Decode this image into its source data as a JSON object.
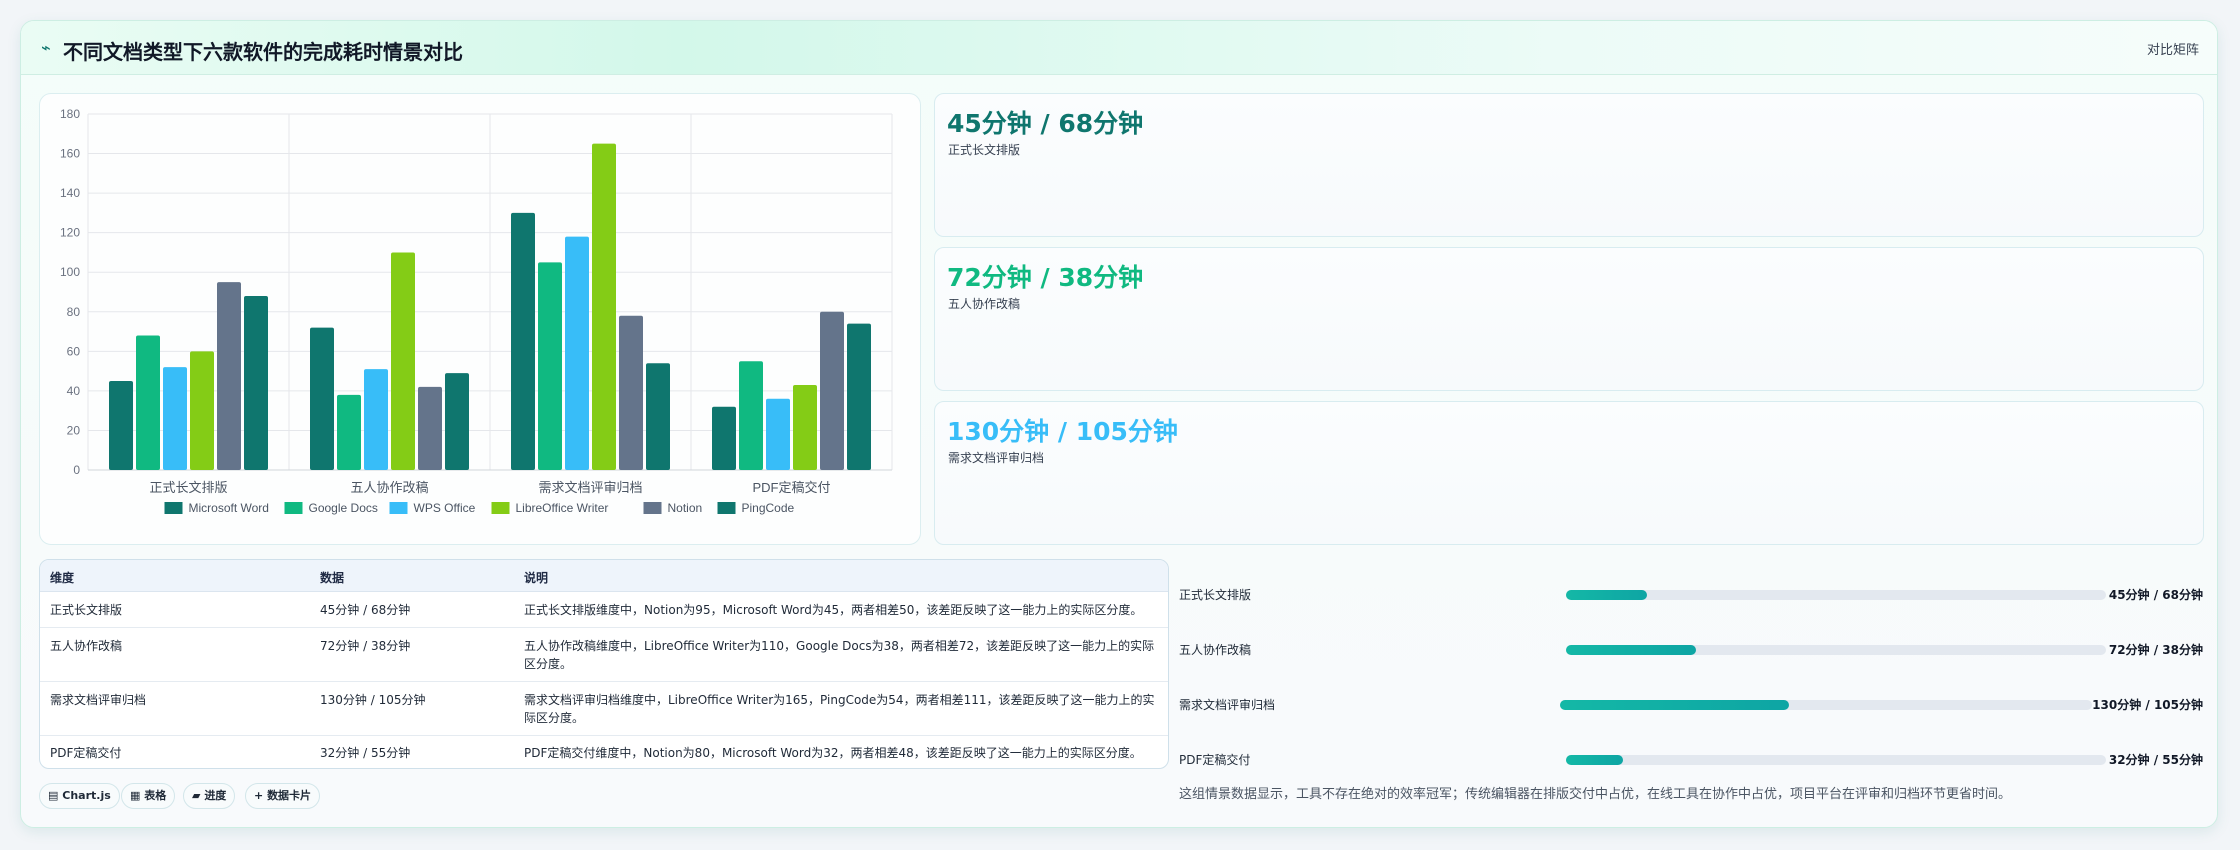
{
  "header": {
    "logo_icon": "trend-icon",
    "title": "不同文档类型下六款软件的完成耗时情景对比",
    "badge": "对比矩阵"
  },
  "chart_data": {
    "type": "bar",
    "categories": [
      "正式长文排版",
      "五人协作改稿",
      "需求文档评审归档",
      "PDF定稿交付"
    ],
    "series": [
      {
        "name": "Microsoft Word",
        "color": "#0f766e",
        "values": [
          45,
          72,
          130,
          32
        ]
      },
      {
        "name": "Google Docs",
        "color": "#10b981",
        "values": [
          68,
          38,
          105,
          55
        ]
      },
      {
        "name": "WPS Office",
        "color": "#38bdf8",
        "values": [
          52,
          51,
          118,
          36
        ]
      },
      {
        "name": "LibreOffice Writer",
        "color": "#84cc16",
        "values": [
          60,
          110,
          165,
          43
        ]
      },
      {
        "name": "Notion",
        "color": "#64748b",
        "values": [
          95,
          42,
          78,
          80
        ]
      },
      {
        "name": "PingCode",
        "color": "#0f766e",
        "values": [
          88,
          49,
          54,
          74
        ]
      }
    ],
    "yticks": [
      "0",
      "20",
      "40",
      "60",
      "80",
      "100",
      "120",
      "140",
      "160",
      "180"
    ],
    "ylim": [
      0,
      180
    ],
    "legend_position": "bottom",
    "grid": true
  },
  "cards": [
    {
      "value": "45分钟 / 68分钟",
      "label": "正式长文排版",
      "color": "#0f766e"
    },
    {
      "value": "72分钟 / 38分钟",
      "label": "五人协作改稿",
      "color": "#10b981"
    },
    {
      "value": "130分钟 / 105分钟",
      "label": "需求文档评审归档",
      "color": "#38bdf8"
    }
  ],
  "table": {
    "headers": [
      "维度",
      "数据",
      "说明"
    ],
    "rows": [
      {
        "dim": "正式长文排版",
        "data": "45分钟 / 68分钟",
        "desc": "正式长文排版维度中，Notion为95，Microsoft Word为45，两者相差50，该差距反映了这一能力上的实际区分度。"
      },
      {
        "dim": "五人协作改稿",
        "data": "72分钟 / 38分钟",
        "desc": "五人协作改稿维度中，LibreOffice Writer为110，Google Docs为38，两者相差72，该差距反映了这一能力上的实际区分度。"
      },
      {
        "dim": "需求文档评审归档",
        "data": "130分钟 / 105分钟",
        "desc": "需求文档评审归档维度中，LibreOffice Writer为165，PingCode为54，两者相差111，该差距反映了这一能力上的实际区分度。"
      },
      {
        "dim": "PDF定稿交付",
        "data": "32分钟 / 55分钟",
        "desc": "PDF定稿交付维度中，Notion为80，Microsoft Word为32，两者相差48，该差距反映了这一能力上的实际区分度。"
      }
    ]
  },
  "chips": [
    {
      "icon": "chart-icon",
      "glyph": "▤",
      "label": "Chart.js"
    },
    {
      "icon": "table-icon",
      "glyph": "▦",
      "label": "表格"
    },
    {
      "icon": "progress-icon",
      "glyph": "▰",
      "label": "进度"
    },
    {
      "icon": "plus-icon",
      "glyph": "+",
      "label": "数据卡片"
    }
  ],
  "progress": [
    {
      "label": "正式长文排版",
      "value": "45分钟 / 68分钟",
      "fraction": 0.15
    },
    {
      "label": "五人协作改稿",
      "value": "72分钟 / 38分钟",
      "fraction": 0.24
    },
    {
      "label": "需求文档评审归档",
      "value": "130分钟 / 105分钟",
      "fraction": 0.43
    },
    {
      "label": "PDF定稿交付",
      "value": "32分钟 / 55分钟",
      "fraction": 0.105
    }
  ],
  "summary": "这组情景数据显示，工具不存在绝对的效率冠军；传统编辑器在排版交付中占优，在线工具在协作中占优，项目平台在评审和归档环节更省时间。"
}
